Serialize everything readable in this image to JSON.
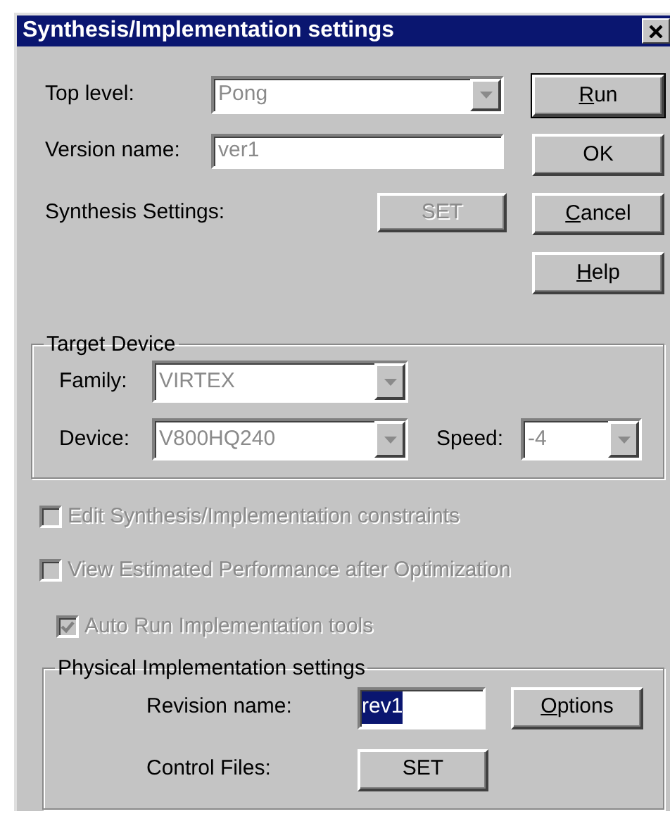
{
  "window": {
    "title": "Synthesis/Implementation settings"
  },
  "top_level": {
    "label": "Top level:",
    "value": "Pong",
    "disabled": true
  },
  "version_name": {
    "label": "Version name:",
    "value": "ver1",
    "disabled": true
  },
  "synthesis_settings": {
    "label": "Synthesis Settings:",
    "button": "SET",
    "disabled": true
  },
  "buttons": [
    {
      "label": "Run",
      "mnemonic": true,
      "default": true
    },
    {
      "label": "OK",
      "mnemonic": false,
      "default": false
    },
    {
      "label": "Cancel",
      "mnemonic": true,
      "default": false
    },
    {
      "label": "Help",
      "mnemonic": true,
      "default": false
    }
  ],
  "target_device": {
    "title": "Target Device",
    "family": {
      "label": "Family:",
      "value": "VIRTEX",
      "disabled": true
    },
    "device": {
      "label": "Device:",
      "value": "V800HQ240",
      "disabled": true
    },
    "speed": {
      "label": "Speed:",
      "value": "-4",
      "disabled": true
    }
  },
  "checkboxes": [
    {
      "label": "Edit Synthesis/Implementation constraints",
      "checked": false,
      "disabled": true
    },
    {
      "label": "View Estimated Performance after Optimization",
      "checked": false,
      "disabled": true
    }
  ],
  "auto_run": {
    "label": "Auto Run Implementation tools",
    "checked": true,
    "disabled": true
  },
  "physical_implementation": {
    "title": "Physical Implementation settings",
    "revision_name": {
      "label": "Revision name:",
      "value": "rev1",
      "selected": true
    },
    "options_button": {
      "label": "Options",
      "mnemonic": true
    },
    "control_files": {
      "label": "Control Files:",
      "button": "SET",
      "disabled": false
    }
  }
}
